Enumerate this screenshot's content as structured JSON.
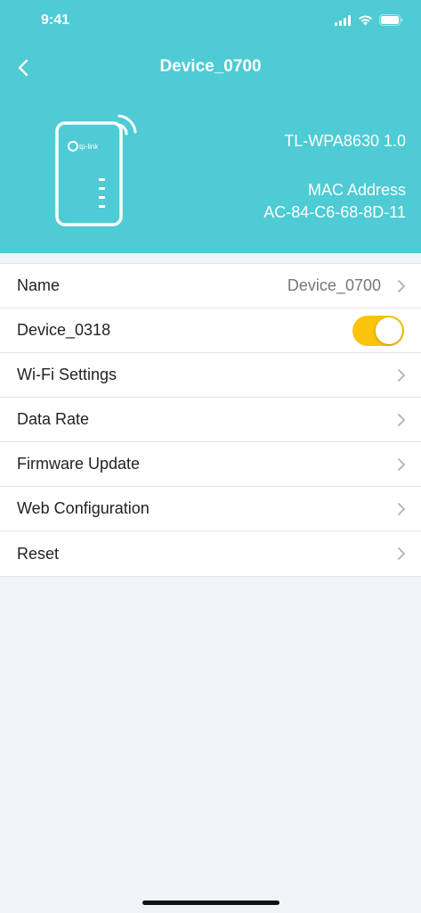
{
  "status_bar": {
    "time": "9:41"
  },
  "nav": {
    "title": "Device_0700",
    "back_icon": "chevron-left-icon"
  },
  "device_info": {
    "logo_text": "tp-link",
    "model": "TL-WPA8630 1.0",
    "mac_label": "MAC Address",
    "mac_value": "AC-84-C6-68-8D-11"
  },
  "settings": {
    "name": {
      "label": "Name",
      "value": "Device_0700"
    },
    "device_toggle": {
      "label": "Device_0318",
      "on": true
    },
    "wifi": {
      "label": "Wi-Fi Settings"
    },
    "data_rate": {
      "label": "Data Rate"
    },
    "firmware": {
      "label": "Firmware Update"
    },
    "web_config": {
      "label": "Web Configuration"
    },
    "reset": {
      "label": "Reset"
    }
  },
  "colors": {
    "header_bg": "#4ecbd4",
    "toggle_on": "#fbc30b",
    "page_bg": "#f0f4f7"
  }
}
